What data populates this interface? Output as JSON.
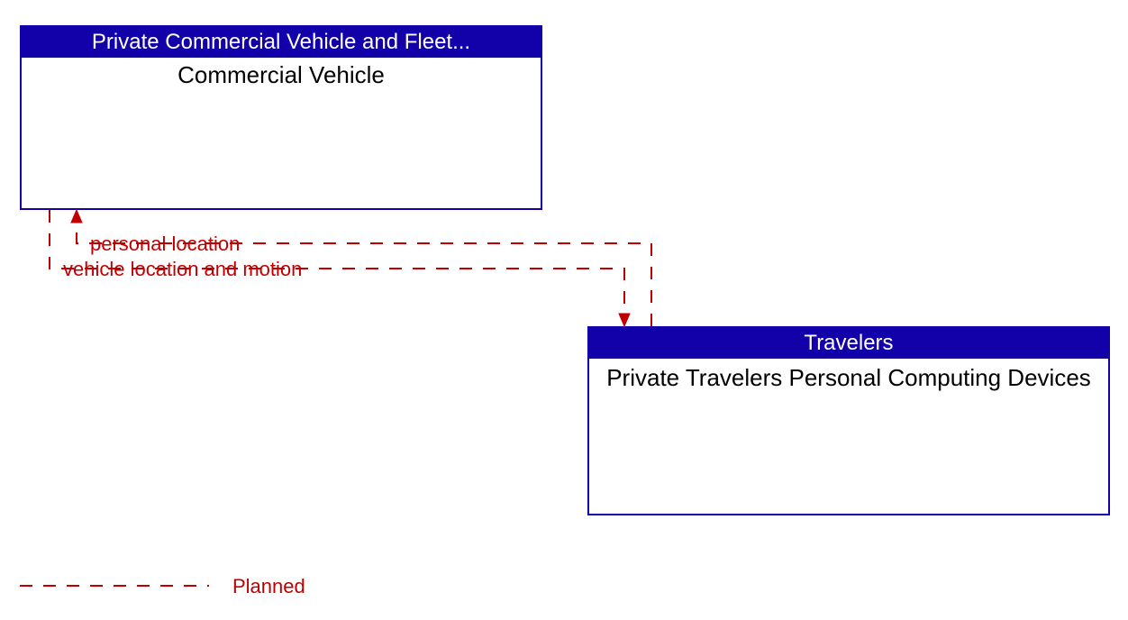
{
  "boxes": {
    "top": {
      "header": "Private Commercial Vehicle and Fleet...",
      "body": "Commercial Vehicle"
    },
    "bottom": {
      "header": "Travelers",
      "body": "Private Travelers Personal Computing Devices"
    }
  },
  "flows": {
    "to_top": "personal location",
    "to_bottom": "vehicle location and motion"
  },
  "legend": {
    "planned": "Planned"
  },
  "colors": {
    "box_border": "#1200a8",
    "header_bg": "#1200a8",
    "header_text": "#ffffff",
    "flow_line": "#c00000",
    "flow_text": "#c00000"
  }
}
